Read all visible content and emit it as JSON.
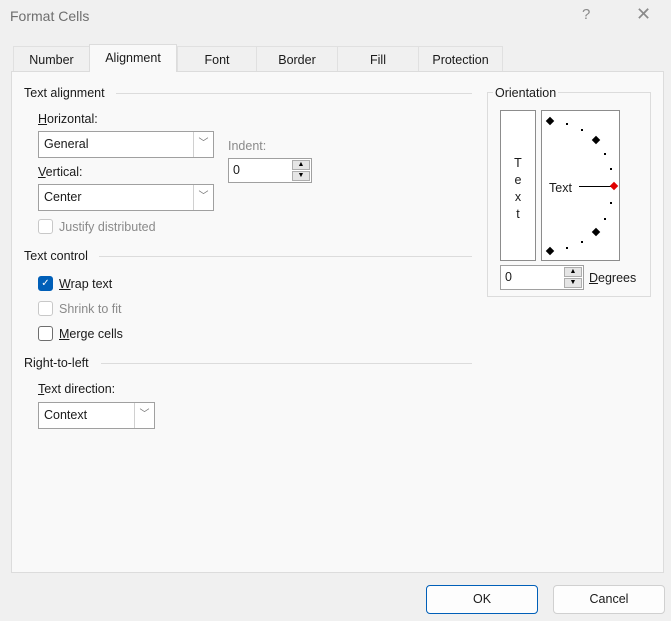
{
  "window": {
    "title": "Format Cells",
    "help_label": "?",
    "close_label": "✕"
  },
  "tabs": [
    {
      "label": "Number",
      "active": false
    },
    {
      "label": "Alignment",
      "active": true
    },
    {
      "label": "Font",
      "active": false
    },
    {
      "label": "Border",
      "active": false
    },
    {
      "label": "Fill",
      "active": false
    },
    {
      "label": "Protection",
      "active": false
    }
  ],
  "text_alignment": {
    "group_label": "Text alignment",
    "horizontal": {
      "label_ul": "H",
      "label_rest": "orizontal:",
      "value": "General"
    },
    "vertical": {
      "label_ul": "V",
      "label_rest": "ertical:",
      "value": "Center"
    },
    "indent": {
      "label": "Indent:",
      "value": "0"
    },
    "justify_distributed": {
      "label": "Justify distributed",
      "checked": false,
      "enabled": false
    }
  },
  "text_control": {
    "group_label": "Text control",
    "wrap_text": {
      "label_ul": "W",
      "label_rest": "rap text",
      "checked": true,
      "check_glyph": "✓"
    },
    "shrink_to_fit": {
      "label": "Shrink to fit",
      "checked": false,
      "enabled": false
    },
    "merge_cells": {
      "label_ul": "M",
      "label_rest": "erge cells",
      "checked": false
    }
  },
  "right_to_left": {
    "group_label": "Right-to-left",
    "text_direction": {
      "label_ul": "T",
      "label_rest": "ext direction:",
      "value": "Context"
    }
  },
  "orientation": {
    "group_label": "Orientation",
    "vertical_text": [
      "T",
      "e",
      "x",
      "t"
    ],
    "dial_text": "Text",
    "degrees_value": "0",
    "degrees_label_ul": "D",
    "degrees_label_rest": "egrees",
    "indicator_color": "#e00000"
  },
  "icons": {
    "chevron": "﹀",
    "up": "▲",
    "down": "▼"
  },
  "buttons": {
    "ok": "OK",
    "cancel": "Cancel"
  }
}
